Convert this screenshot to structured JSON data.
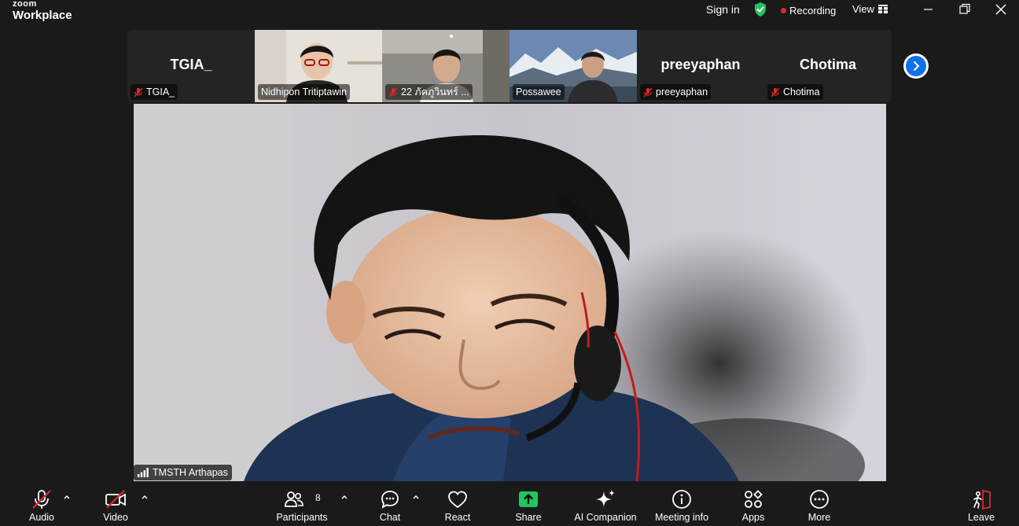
{
  "window": {
    "brand_top": "zoom",
    "brand_bottom": "Workplace",
    "sign_in": "Sign in",
    "recording": "Recording",
    "view": "View",
    "icons": [
      "shield-check-icon",
      "grid-icon",
      "minimize-icon",
      "restore-icon",
      "close-icon"
    ],
    "colors": {
      "shield": "#22c55e",
      "rec_dot": "#e02828",
      "accent": "#0e71eb"
    }
  },
  "thumbnails": [
    {
      "big_name": "TGIA_",
      "label": "TGIA_",
      "muted": true
    },
    {
      "big_name": "",
      "label": "Nidhipon Tritiptawin",
      "muted": false
    },
    {
      "big_name": "",
      "label": "22 ภัคภูวินทร์ ...",
      "muted": true
    },
    {
      "big_name": "",
      "label": "Possawee",
      "muted": false
    },
    {
      "big_name": "preeyaphan",
      "label": "preeyaphan",
      "muted": true
    },
    {
      "big_name": "Chotima",
      "label": "Chotima",
      "muted": true
    }
  ],
  "main_speaker": {
    "label": "TMSTH Arthapas"
  },
  "toolbar": {
    "audio": "Audio",
    "video": "Video",
    "participants": "Participants",
    "participants_count": "8",
    "chat": "Chat",
    "react": "React",
    "share": "Share",
    "ai_companion": "AI Companion",
    "meeting_info": "Meeting info",
    "apps": "Apps",
    "more": "More",
    "leave": "Leave",
    "share_color": "#22c55e",
    "leave_color": "#e02828"
  }
}
